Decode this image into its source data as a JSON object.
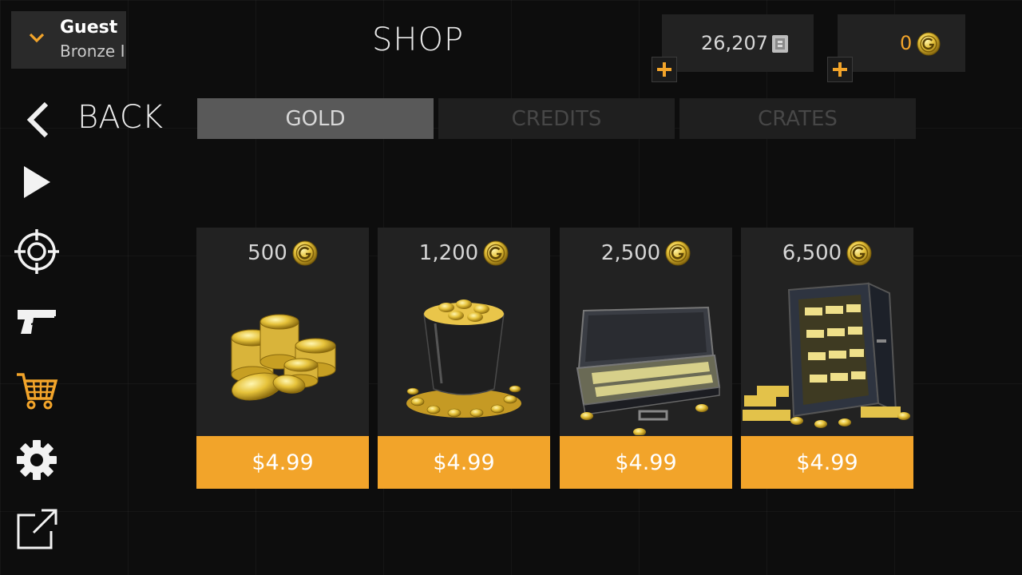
{
  "profile": {
    "name": "Guest",
    "rank": "Bronze I"
  },
  "header": {
    "title": "SHOP"
  },
  "currency": {
    "credits": {
      "value": "26,207",
      "icon": "credits-icon",
      "color": "#d6d6d6"
    },
    "gold": {
      "value": "0",
      "icon": "gold-coin-icon",
      "color": "#f2a42a"
    }
  },
  "nav": {
    "back_label": "BACK"
  },
  "tabs": [
    {
      "label": "GOLD",
      "active": true
    },
    {
      "label": "CREDITS",
      "active": false
    },
    {
      "label": "CRATES",
      "active": false
    }
  ],
  "sidebar": [
    {
      "icon": "play-icon"
    },
    {
      "icon": "crosshair-icon"
    },
    {
      "icon": "pistol-icon"
    },
    {
      "icon": "cart-icon",
      "active": true
    },
    {
      "icon": "gear-icon"
    },
    {
      "icon": "external-link-icon"
    }
  ],
  "offers": [
    {
      "amount": "500",
      "price": "$4.99",
      "art": "coin-stacks"
    },
    {
      "amount": "1,200",
      "price": "$4.99",
      "art": "coin-bucket"
    },
    {
      "amount": "2,500",
      "price": "$4.99",
      "art": "briefcase"
    },
    {
      "amount": "6,500",
      "price": "$4.99",
      "art": "vault"
    }
  ],
  "colors": {
    "accent": "#f2a42a",
    "active_tab": "#595959",
    "inactive_tab": "#1f1f1f"
  }
}
